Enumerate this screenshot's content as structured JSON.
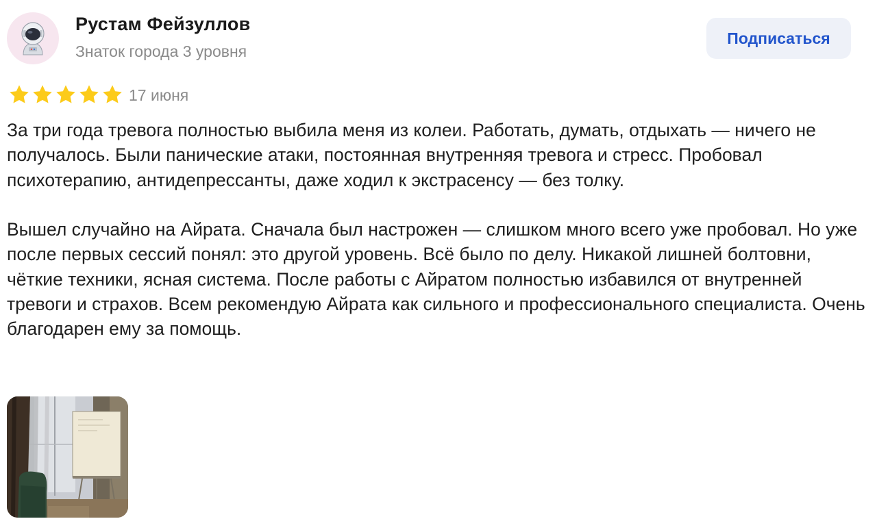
{
  "author": {
    "name": "Рустам Фейзуллов",
    "level": "Знаток города 3 уровня",
    "avatar_icon": "astronaut-icon",
    "avatar_bg": "#f7e6ef"
  },
  "actions": {
    "subscribe_label": "Подписаться"
  },
  "review": {
    "rating": 5,
    "rating_max": 5,
    "star_color": "#fccb1a",
    "date": "17 июня",
    "paragraphs": [
      "За три года тревога полностью выбила меня из колеи. Работать, думать, отдыхать — ничего не получалось. Были панические атаки, постоянная внутренняя тревога и стресс. Пробовал психотерапию, антидепрессанты, даже ходил к экстрасенсу — без толку.",
      "Вышел случайно на Айрата. Сначала был настрожен — слишком много всего уже пробовал. Но уже после первых сессий понял: это другой уровень. Всё было по делу. Никакой лишней болтовни, чёткие техники, ясная система. После работы с Айратом полностью избавился от внутренней тревоги и страхов. Всем рекомендую Айрата как сильного и профессионального специалиста. Очень благодарен ему за помощь."
    ],
    "photos_count": 1
  },
  "colors": {
    "accent": "#2255cc",
    "button_bg": "#eef1f8",
    "secondary_text": "#8a8a8a"
  }
}
